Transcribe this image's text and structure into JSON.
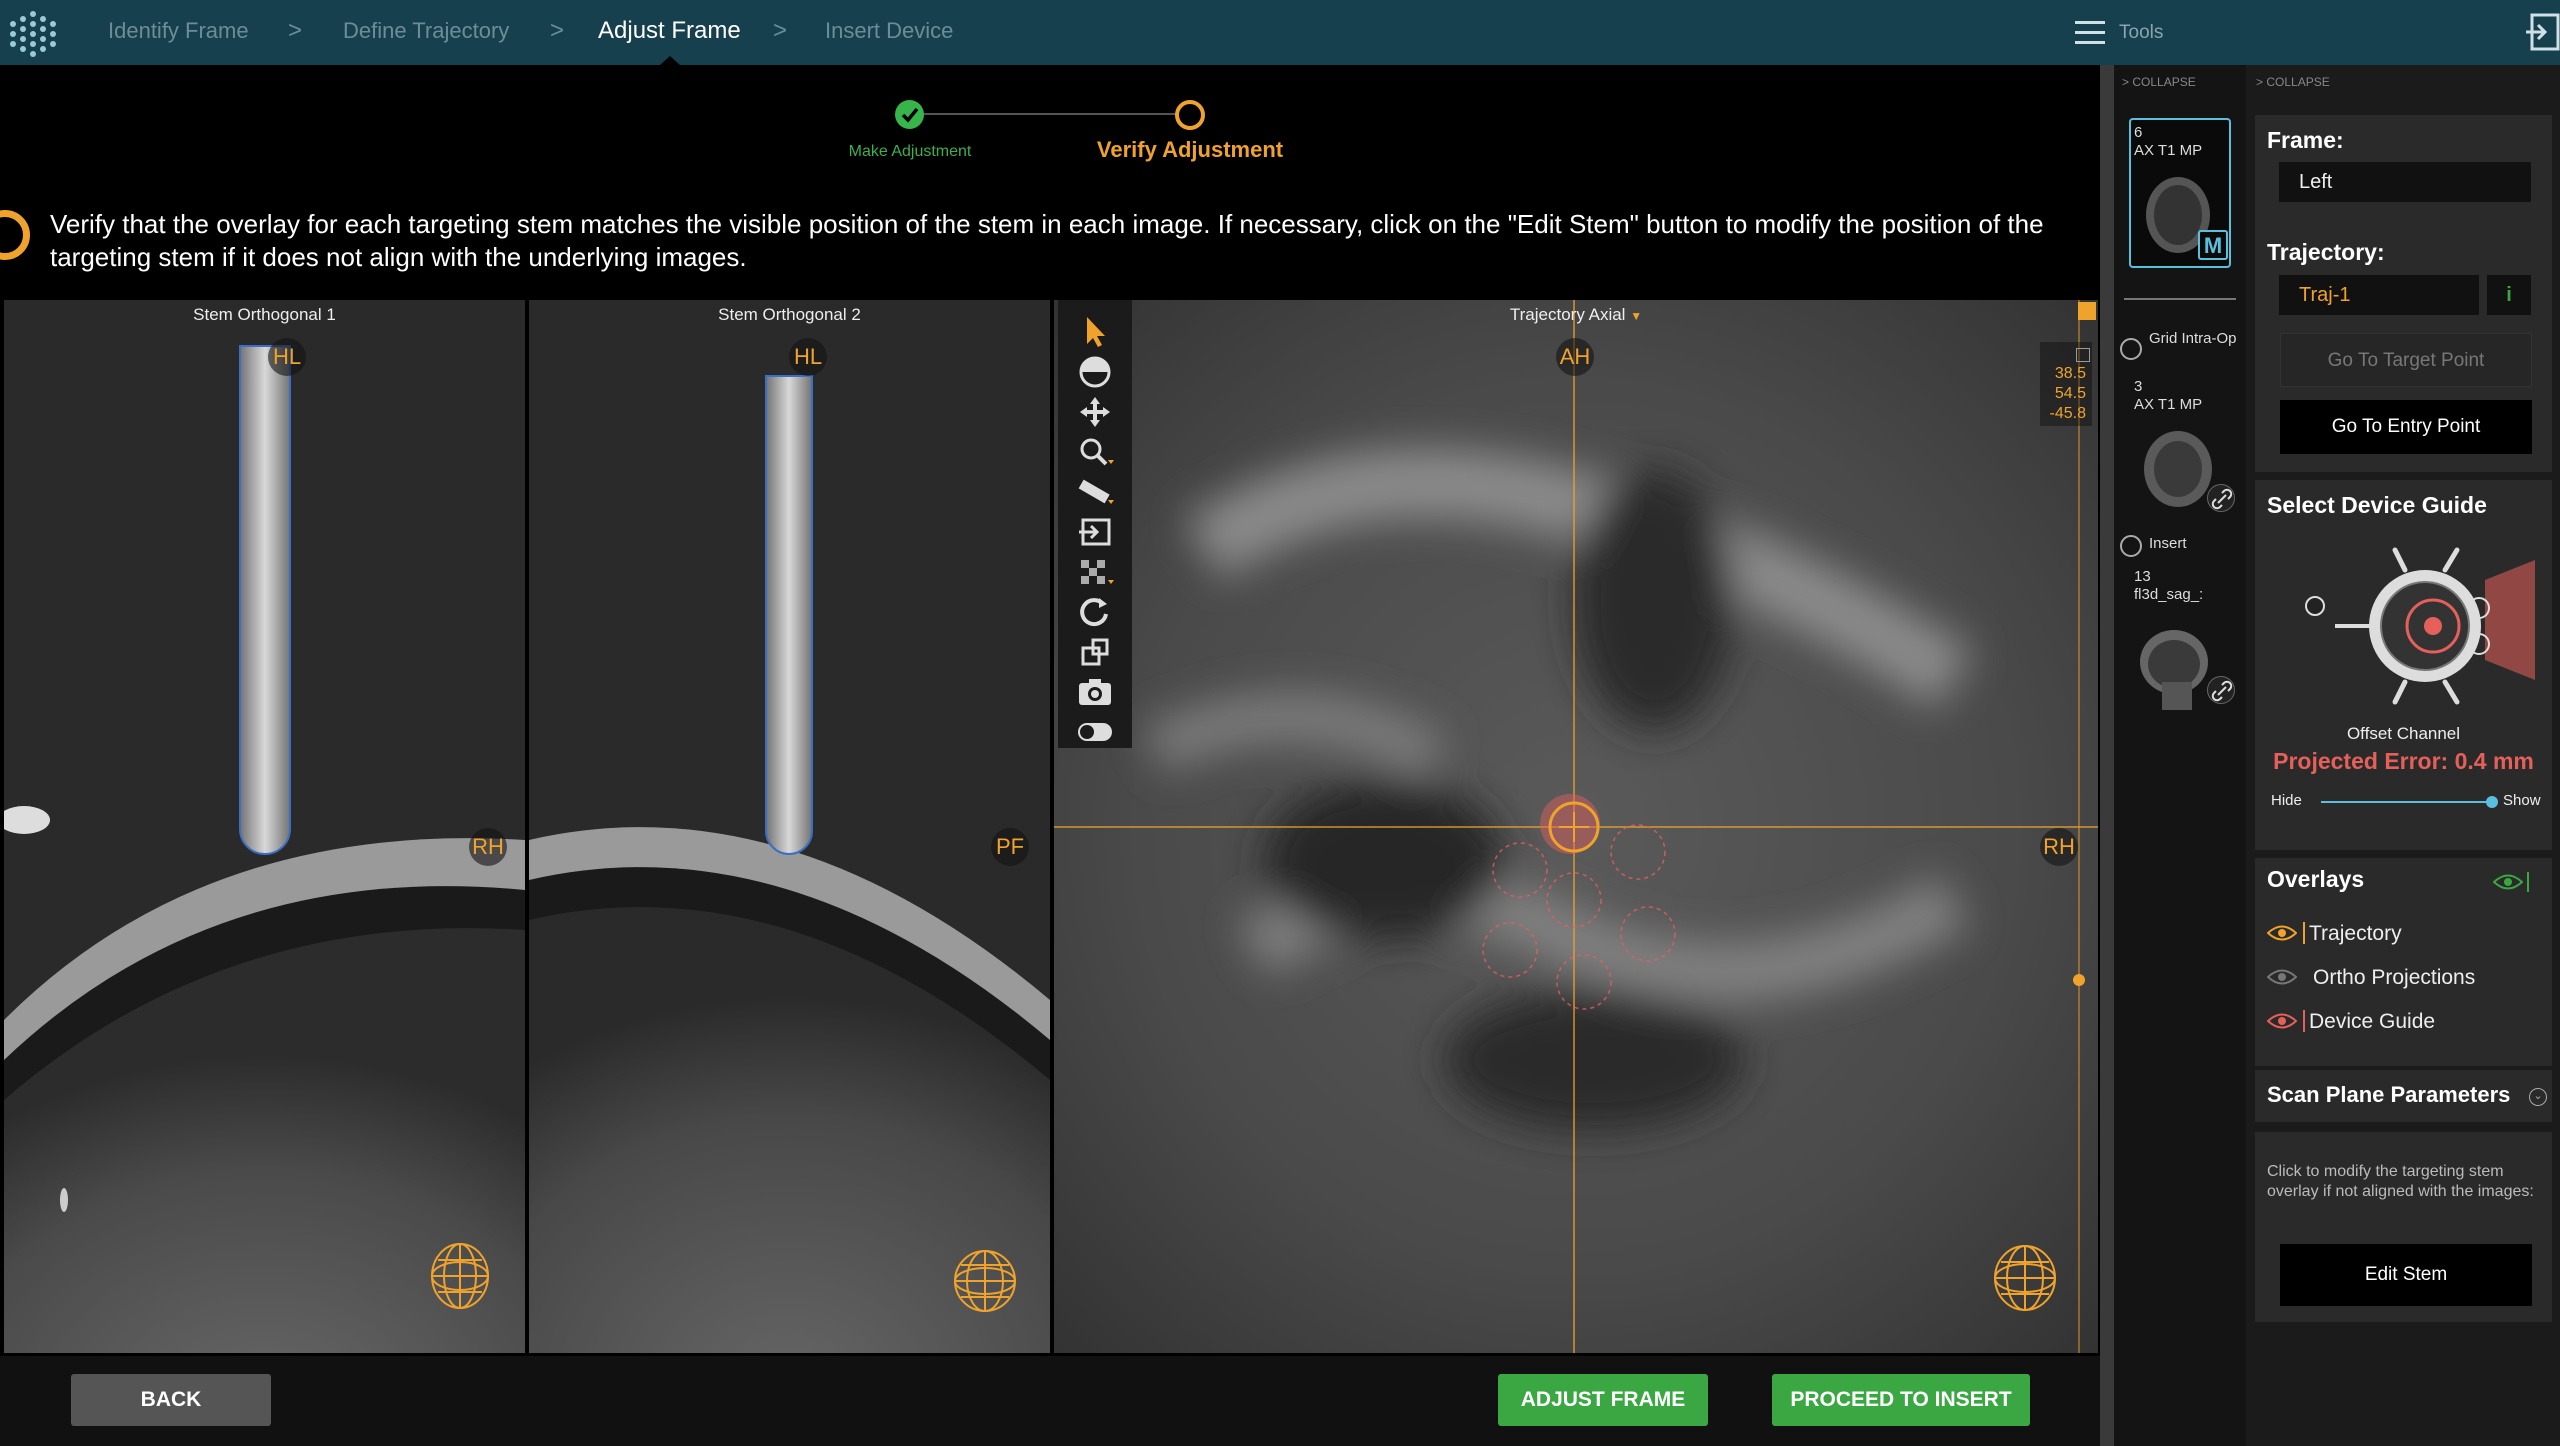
{
  "breadcrumb": {
    "items": [
      {
        "label": "Identify Frame",
        "state": "inactive"
      },
      {
        "label": "Define Trajectory",
        "state": "inactive"
      },
      {
        "label": "Adjust Frame",
        "state": "active"
      },
      {
        "label": "Insert Device",
        "state": "inactive"
      }
    ],
    "separator": ">"
  },
  "tools": {
    "label": "Tools",
    "icon": "hamburger-icon"
  },
  "stepper": {
    "steps": [
      {
        "label": "Make Adjustment",
        "state": "done"
      },
      {
        "label": "Verify Adjustment",
        "state": "current"
      }
    ]
  },
  "instruction": "Verify that the overlay for each targeting stem matches the visible position of the stem in each image.  If necessary, click on the \"Edit Stem\" button to modify the position of the targeting stem if it does not align with the underlying images.",
  "viewports": [
    {
      "title": "Stem Orthogonal 1",
      "top_label": "HL",
      "side_label": "RH"
    },
    {
      "title": "Stem Orthogonal 2",
      "top_label": "HL",
      "side_label": "PF"
    },
    {
      "title": "Trajectory Axial",
      "top_label": "AH",
      "side_label": "RH",
      "coords": [
        "38.5",
        "54.5",
        "-45.8"
      ]
    }
  ],
  "bottom": {
    "back": "BACK",
    "adjust_frame": "ADJUST FRAME",
    "proceed": "PROCEED TO INSERT"
  },
  "thumbnails": {
    "collapse": "COLLAPSE",
    "series": [
      {
        "number": "6",
        "name": "AX T1 MP",
        "badge": "M"
      },
      {
        "group": "Grid Intra-Op",
        "number": "3",
        "name": "AX T1 MP"
      },
      {
        "group": "Insert",
        "number": "13",
        "name": "fl3d_sag_:"
      }
    ]
  },
  "panel": {
    "collapse": "COLLAPSE",
    "frame_label": "Frame:",
    "frame_value": "Left",
    "trajectory_label": "Trajectory:",
    "trajectory_value": "Traj-1",
    "info": "i",
    "go_target": "Go To Target Point",
    "go_entry": "Go To Entry Point",
    "device_guide_title": "Select Device Guide",
    "device_channel": "Offset Channel",
    "projected_error": "Projected Error: 0.4 mm",
    "slider": {
      "min_label": "Hide",
      "max_label": "Show",
      "value": 1.0
    },
    "overlays_title": "Overlays",
    "overlays": [
      {
        "label": "Trajectory",
        "visible": true,
        "color": "#f0a32c"
      },
      {
        "label": "Ortho Projections",
        "visible": false,
        "color": "#888888"
      },
      {
        "label": "Device Guide",
        "visible": true,
        "color": "#e5605a"
      }
    ],
    "scan_plane_title": "Scan Plane Parameters",
    "edit_hint": "Click to modify the targeting stem overlay if not aligned with the images:",
    "edit_stem": "Edit Stem"
  },
  "colors": {
    "accent_orange": "#f0a32c",
    "accent_green": "#3aa742",
    "topbar": "#17404f",
    "error_red": "#e5605a",
    "stem_blue": "#3a6fc4"
  }
}
